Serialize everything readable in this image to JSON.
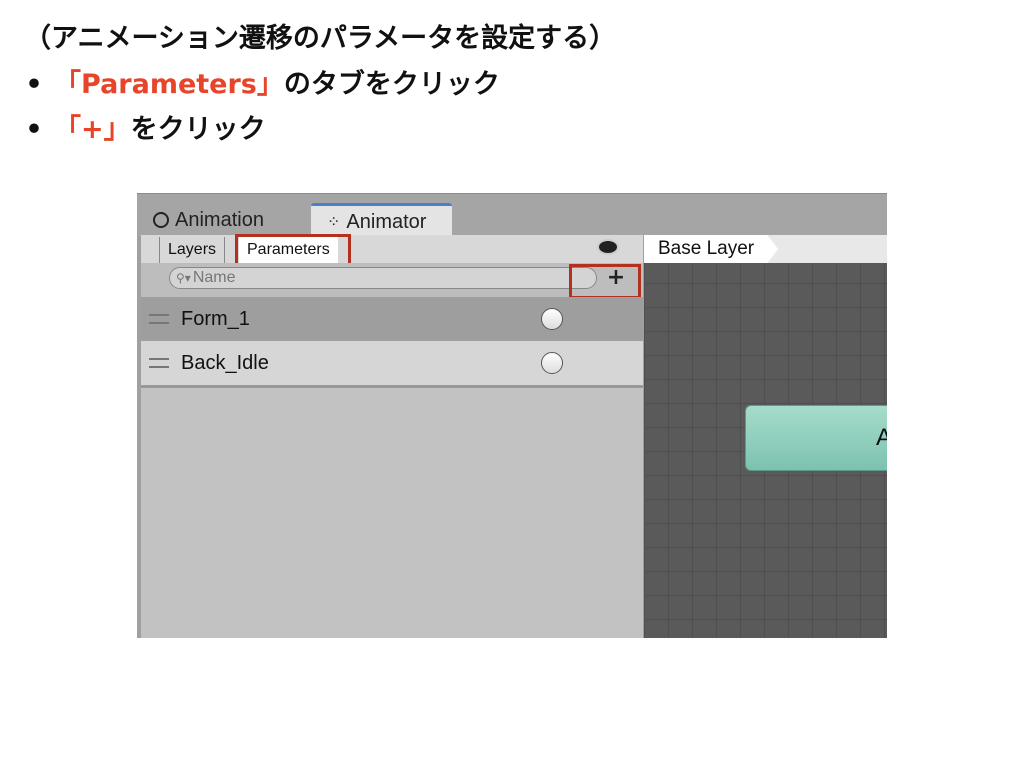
{
  "slide": {
    "heading": "（アニメーション遷移のパラメータを設定する）",
    "bullets": [
      {
        "bullet": "•",
        "highlight": "「Parameters」",
        "text": "のタブをクリック"
      },
      {
        "bullet": "•",
        "highlight": "「+」",
        "text": "をクリック"
      }
    ],
    "highlight_color": "#e8442a"
  },
  "window": {
    "tabs": [
      {
        "label": "Animation",
        "icon": "clock-icon"
      },
      {
        "label": "Animator",
        "icon": "animator-icon",
        "active": true
      }
    ],
    "subtabs": [
      "Layers",
      "Parameters"
    ],
    "active_subtab": "Parameters",
    "search_placeholder": "Name",
    "add_button": "+",
    "parameters": [
      {
        "name": "Form_1",
        "value": false
      },
      {
        "name": "Back_Idle",
        "value": false
      }
    ],
    "breadcrumb": "Base Layer",
    "state_node_label": "A",
    "highlight_box_color": "#b3321f"
  }
}
